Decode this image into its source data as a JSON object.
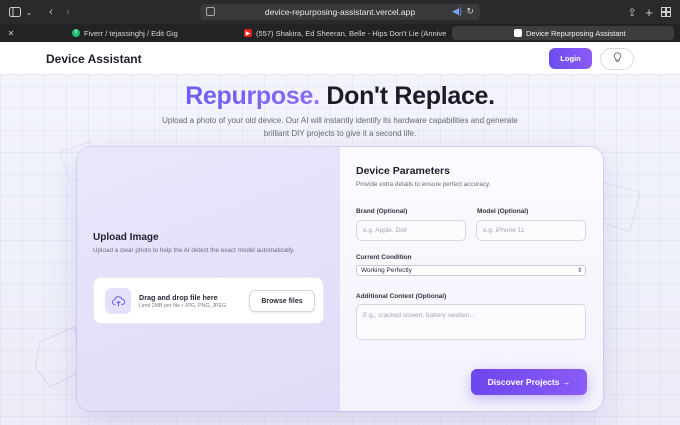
{
  "browser": {
    "url": "device-repurposing-assistant.vercel.app",
    "tabs": [
      {
        "label": "Fiverr / tejassinghj / Edit Gig"
      },
      {
        "label": "(557) Shakira, Ed Sheeran, Belle - Hips Don't Lie (Anniversary..."
      },
      {
        "label": "Device Repurposing Assistant"
      }
    ]
  },
  "header": {
    "brand": "Device Assistant",
    "login_label": "Login"
  },
  "hero": {
    "title_accent": "Repurpose.",
    "title_rest": " Don't Replace.",
    "subtitle": "Upload a photo of your old device. Our AI will instantly identify its hardware capabilities and generate brilliant DIY projects to give it a second life."
  },
  "upload": {
    "title": "Upload Image",
    "description": "Upload a clear photo to help the AI detect the exact model automatically.",
    "drop_title": "Drag and drop file here",
    "drop_hint": "Limit 2MB per file • JPG, PNG, JPEG",
    "browse_label": "Browse files"
  },
  "params": {
    "title": "Device Parameters",
    "description": "Provide extra details to ensure perfect accuracy.",
    "brand_label": "Brand (Optional)",
    "brand_placeholder": "e.g. Apple, Dell",
    "model_label": "Model (Optional)",
    "model_placeholder": "e.g. iPhone 11",
    "condition_label": "Current Condition",
    "condition_value": "Working Perfectly",
    "context_label": "Additional Context (Optional)",
    "context_placeholder": "E.g., cracked screen, battery swollen...",
    "discover_label": "Discover Projects →"
  },
  "colors": {
    "accent": "#6d5cf6",
    "accent_end": "#8b5cf6"
  }
}
